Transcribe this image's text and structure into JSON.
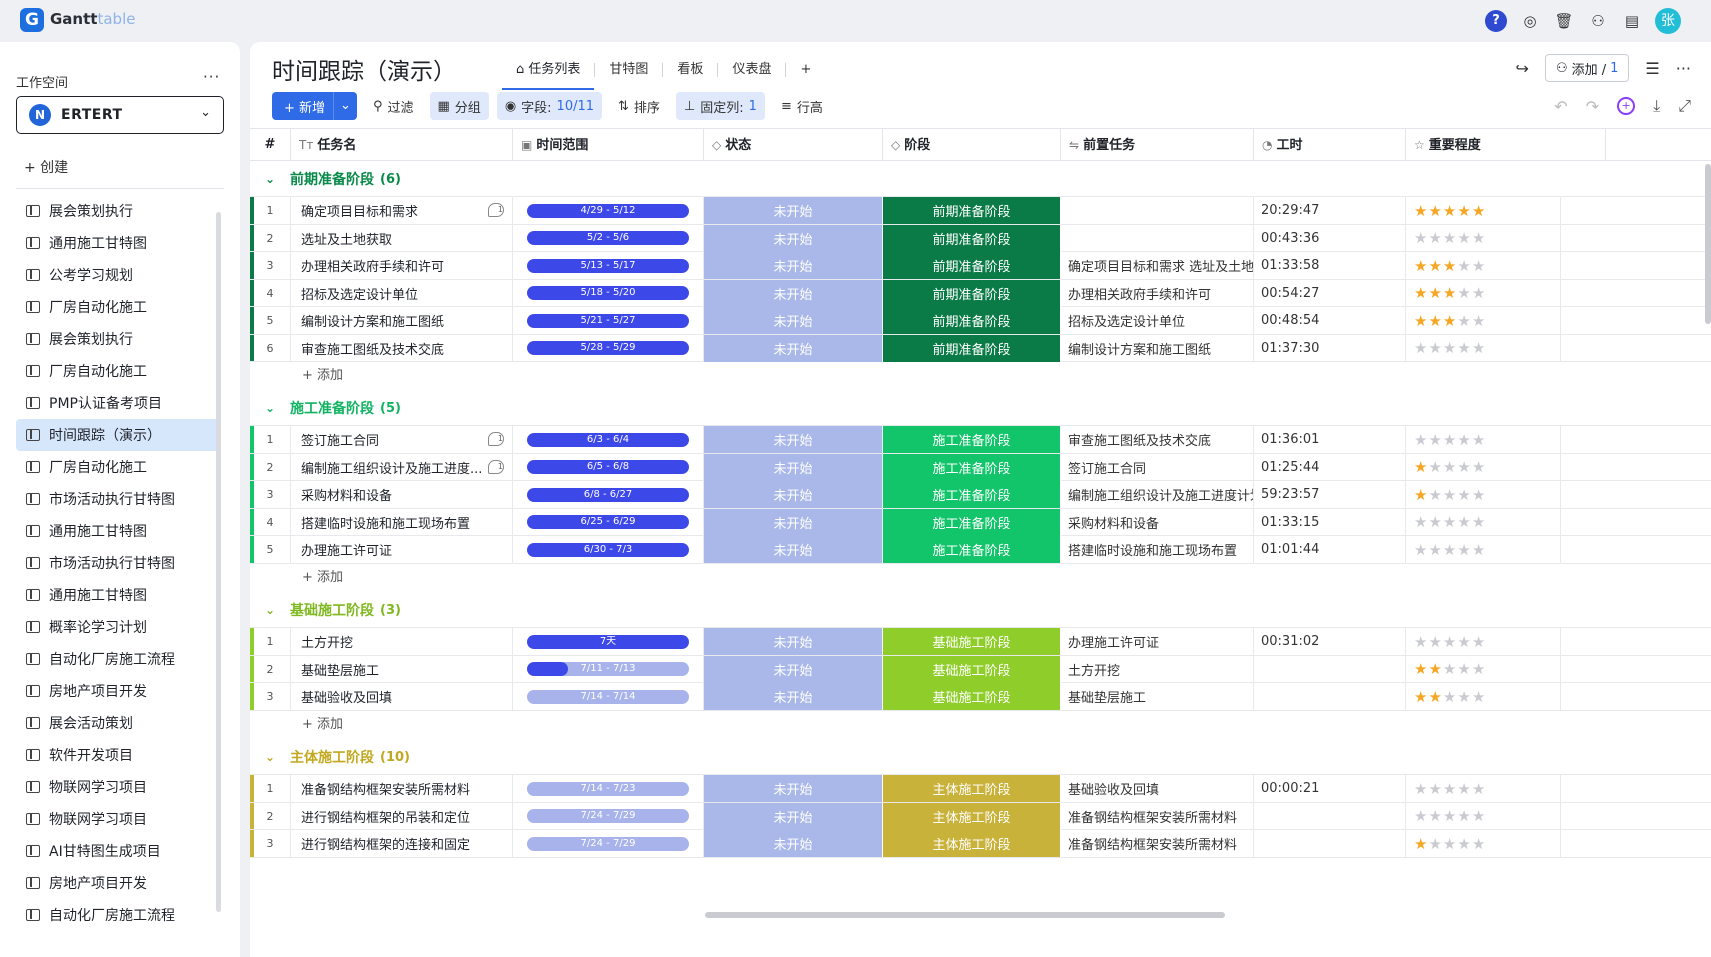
{
  "app": {
    "logo_letter": "G",
    "name_main": "Gantt",
    "name_sub": "table",
    "avatar": "张"
  },
  "sidebar": {
    "workspace_label": "工作空间",
    "workspace_badge": "N",
    "workspace_name": "ERTERT",
    "create_label": "+ 创建",
    "items": [
      "展会策划执行",
      "通用施工甘特图",
      "公考学习规划",
      "厂房自动化施工",
      "展会策划执行",
      "厂房自动化施工",
      "PMP认证备考项目",
      "时间跟踪（演示）",
      "厂房自动化施工",
      "市场活动执行甘特图",
      "通用施工甘特图",
      "市场活动执行甘特图",
      "通用施工甘特图",
      "概率论学习计划",
      "自动化厂房施工流程",
      "房地产项目开发",
      "展会活动策划",
      "软件开发项目",
      "物联网学习项目",
      "物联网学习项目",
      "AI甘特图生成项目",
      "房地产项目开发",
      "自动化厂房施工流程"
    ],
    "active_index": 7
  },
  "header": {
    "title": "时间跟踪（演示）",
    "tabs": [
      "任务列表",
      "甘特图",
      "看板",
      "仪表盘"
    ],
    "add_label": "添加 /",
    "add_count": "1"
  },
  "toolbar": {
    "new_label": "新增",
    "filter_label": "过滤",
    "group_label": "分组",
    "fields_label": "字段:",
    "fields_value": "10/11",
    "sort_label": "排序",
    "pin_label": "固定列:",
    "pin_value": "1",
    "rowheight_label": "行高"
  },
  "columns": [
    "#",
    "任务名",
    "时间范围",
    "状态",
    "阶段",
    "前置任务",
    "工时",
    "重要程度"
  ],
  "add_row_label": "+ 添加",
  "groups": [
    {
      "name": "前期准备阶段",
      "count": "(6)",
      "color": "#0a7a46",
      "title_color": "#0a8a4a",
      "rows": [
        {
          "n": "1",
          "name": "确定项目目标和需求",
          "cm": "1",
          "range": "4/29 - 5/12",
          "fill": 1,
          "status": "未开始",
          "stage": "前期准备阶段",
          "pre": "",
          "hours": "20:29:47",
          "stars": 5
        },
        {
          "n": "2",
          "name": "选址及土地获取",
          "cm": "",
          "range": "5/2 - 5/6",
          "fill": 1,
          "status": "未开始",
          "stage": "前期准备阶段",
          "pre": "",
          "hours": "00:43:36",
          "stars": 0
        },
        {
          "n": "3",
          "name": "办理相关政府手续和许可",
          "cm": "",
          "range": "5/13 - 5/17",
          "fill": 1,
          "status": "未开始",
          "stage": "前期准备阶段",
          "pre": "确定项目目标和需求  选址及土地",
          "hours": "01:33:58",
          "stars": 3
        },
        {
          "n": "4",
          "name": "招标及选定设计单位",
          "cm": "",
          "range": "5/18 - 5/20",
          "fill": 1,
          "status": "未开始",
          "stage": "前期准备阶段",
          "pre": "办理相关政府手续和许可",
          "hours": "00:54:27",
          "stars": 3
        },
        {
          "n": "5",
          "name": "编制设计方案和施工图纸",
          "cm": "",
          "range": "5/21 - 5/27",
          "fill": 1,
          "status": "未开始",
          "stage": "前期准备阶段",
          "pre": "招标及选定设计单位",
          "hours": "00:48:54",
          "stars": 3
        },
        {
          "n": "6",
          "name": "审查施工图纸及技术交底",
          "cm": "",
          "range": "5/28 - 5/29",
          "fill": 1,
          "status": "未开始",
          "stage": "前期准备阶段",
          "pre": "编制设计方案和施工图纸",
          "hours": "01:37:30",
          "stars": 0
        }
      ]
    },
    {
      "name": "施工准备阶段",
      "count": "(5)",
      "color": "#12c46a",
      "title_color": "#12b463",
      "rows": [
        {
          "n": "1",
          "name": "签订施工合同",
          "cm": "1",
          "range": "6/3 - 6/4",
          "fill": 1,
          "status": "未开始",
          "stage": "施工准备阶段",
          "pre": "审查施工图纸及技术交底",
          "hours": "01:36:01",
          "stars": 0
        },
        {
          "n": "2",
          "name": "编制施工组织设计及施工进度...",
          "cm": "1",
          "range": "6/5 - 6/8",
          "fill": 1,
          "status": "未开始",
          "stage": "施工准备阶段",
          "pre": "签订施工合同",
          "hours": "01:25:44",
          "stars": 1
        },
        {
          "n": "3",
          "name": "采购材料和设备",
          "cm": "",
          "range": "6/8 - 6/27",
          "fill": 1,
          "status": "未开始",
          "stage": "施工准备阶段",
          "pre": "编制施工组织设计及施工进度计划",
          "hours": "59:23:57",
          "stars": 1
        },
        {
          "n": "4",
          "name": "搭建临时设施和施工现场布置",
          "cm": "",
          "range": "6/25 - 6/29",
          "fill": 1,
          "status": "未开始",
          "stage": "施工准备阶段",
          "pre": "采购材料和设备",
          "hours": "01:33:15",
          "stars": 0
        },
        {
          "n": "5",
          "name": "办理施工许可证",
          "cm": "",
          "range": "6/30 - 7/3",
          "fill": 1,
          "status": "未开始",
          "stage": "施工准备阶段",
          "pre": "搭建临时设施和施工现场布置",
          "hours": "01:01:44",
          "stars": 0
        }
      ]
    },
    {
      "name": "基础施工阶段",
      "count": "(3)",
      "color": "#8fce2a",
      "title_color": "#7fb81f",
      "rows": [
        {
          "n": "1",
          "name": "土方开挖",
          "cm": "",
          "range": "7天",
          "fill": 1,
          "status": "未开始",
          "stage": "基础施工阶段",
          "pre": "办理施工许可证",
          "hours": "00:31:02",
          "stars": 0
        },
        {
          "n": "2",
          "name": "基础垫层施工",
          "cm": "",
          "range": "7/11 - 7/13",
          "fill": 0.25,
          "status": "未开始",
          "stage": "基础施工阶段",
          "pre": "土方开挖",
          "hours": "",
          "stars": 2
        },
        {
          "n": "3",
          "name": "基础验收及回填",
          "cm": "",
          "range": "7/14 - 7/14",
          "fill": 0,
          "status": "未开始",
          "stage": "基础施工阶段",
          "pre": "基础垫层施工",
          "hours": "",
          "stars": 2
        }
      ]
    },
    {
      "name": "主体施工阶段",
      "count": "(10)",
      "color": "#c9b23a",
      "title_color": "#c2a820",
      "rows": [
        {
          "n": "1",
          "name": "准备钢结构框架安装所需材料",
          "cm": "",
          "range": "7/14 - 7/23",
          "fill": 0,
          "status": "未开始",
          "stage": "主体施工阶段",
          "pre": "基础验收及回填",
          "hours": "00:00:21",
          "stars": 0
        },
        {
          "n": "2",
          "name": "进行钢结构框架的吊装和定位",
          "cm": "",
          "range": "7/24 - 7/29",
          "fill": 0,
          "status": "未开始",
          "stage": "主体施工阶段",
          "pre": "准备钢结构框架安装所需材料",
          "hours": "",
          "stars": 0
        },
        {
          "n": "3",
          "name": "进行钢结构框架的连接和固定",
          "cm": "",
          "range": "7/24 - 7/29",
          "fill": 0,
          "status": "未开始",
          "stage": "主体施工阶段",
          "pre": "准备钢结构框架安装所需材料",
          "hours": "",
          "stars": 1
        }
      ]
    }
  ],
  "colors": {
    "accent": "#2f6be7",
    "status_bg": "#a9b8e8",
    "bar_fill": "#3d48e8",
    "bar_empty": "#a7b3ea",
    "star_on": "#f5a623",
    "star_off": "#c9cbd0"
  }
}
